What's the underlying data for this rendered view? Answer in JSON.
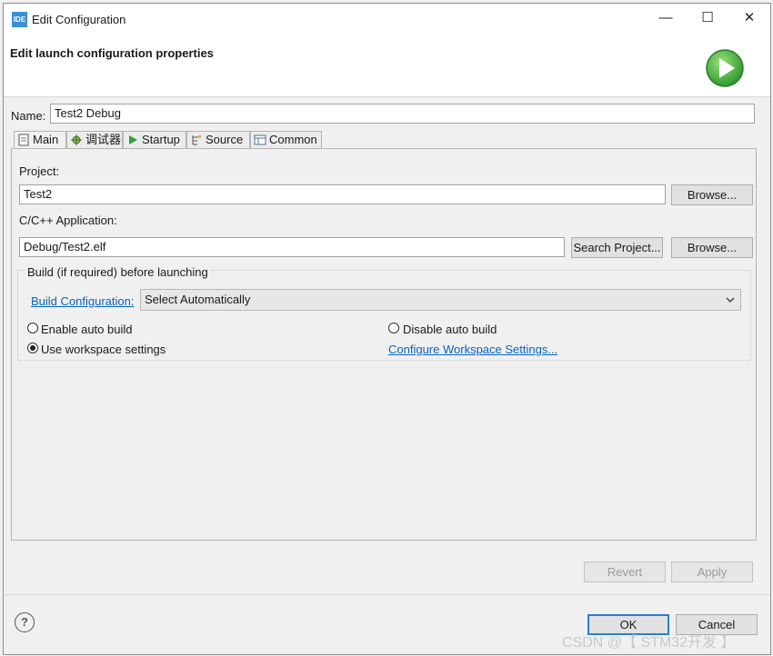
{
  "window": {
    "title": "Edit Configuration",
    "app_icon_text": "IDE",
    "controls": {
      "minimize": "—",
      "maximize": "☐",
      "close": "✕"
    }
  },
  "header": {
    "title": "Edit launch configuration properties",
    "run_icon": "green-play-icon"
  },
  "name": {
    "label": "Name:",
    "value": "Test2 Debug"
  },
  "tabs": [
    {
      "label": "Main",
      "icon": "document-icon",
      "active": true
    },
    {
      "label": "调试器",
      "icon": "bug-gear-icon",
      "active": false
    },
    {
      "label": "Startup",
      "icon": "play-icon",
      "active": false
    },
    {
      "label": "Source",
      "icon": "source-icon",
      "active": false
    },
    {
      "label": "Common",
      "icon": "table-icon",
      "active": false
    }
  ],
  "main": {
    "project_label": "Project:",
    "project_value": "Test2",
    "project_browse": "Browse...",
    "app_label": "C/C++ Application:",
    "app_value": "Debug/Test2.elf",
    "search_project": "Search Project...",
    "app_browse": "Browse...",
    "build": {
      "title": "Build (if required) before launching",
      "config_link": "Build Configuration:",
      "config_value": "Select Automatically",
      "enable_auto": "Enable auto build",
      "disable_auto": "Disable auto build",
      "use_workspace": "Use workspace settings",
      "configure_workspace": "Configure Workspace Settings...",
      "selected": "use_workspace"
    }
  },
  "buttons": {
    "revert": "Revert",
    "apply": "Apply",
    "ok": "OK",
    "cancel": "Cancel"
  },
  "help_icon": "?",
  "watermark": "CSDN @【 STM32开发 】",
  "colors": {
    "accent": "#2a7fd4",
    "link": "#0563c1",
    "run_green": "#3aa23a"
  }
}
